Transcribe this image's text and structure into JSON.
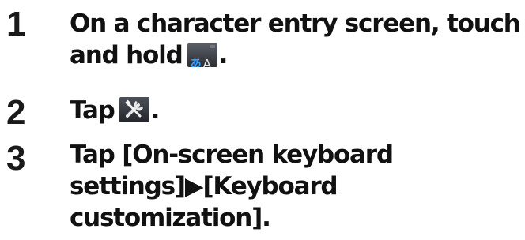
{
  "steps": [
    {
      "number": "1",
      "lines": [
        "On a character entry screen, touch",
        "and hold",
        "."
      ],
      "icon": "input-mode-icon"
    },
    {
      "number": "2",
      "lines": [
        "Tap",
        "."
      ],
      "icon": "settings-tools-icon"
    },
    {
      "number": "3",
      "lines": [
        "Tap [On-screen keyboard",
        "settings]▶[Keyboard",
        "customization]."
      ]
    }
  ],
  "icons": {
    "input_mode": {
      "jp": "あ",
      "en": "A"
    }
  }
}
